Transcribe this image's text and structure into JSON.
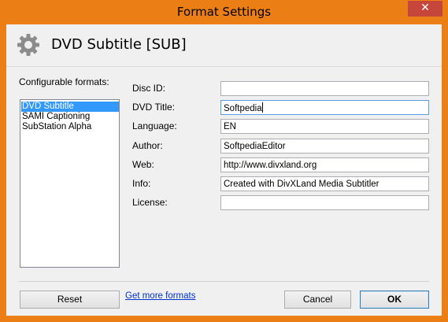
{
  "window": {
    "title": "Format Settings",
    "close_glyph": "✕"
  },
  "header": {
    "title": "DVD Subtitle [SUB]",
    "icon": "gear-icon"
  },
  "formats": {
    "label": "Configurable formats:",
    "items": [
      {
        "label": "DVD Subtitle",
        "selected": true
      },
      {
        "label": "SAMI Captioning",
        "selected": false
      },
      {
        "label": "SubStation Alpha",
        "selected": false
      }
    ]
  },
  "fields": {
    "disc_id": {
      "label": "Disc ID:",
      "value": ""
    },
    "dvd_title": {
      "label": "DVD Title:",
      "value": "Softpedia"
    },
    "language": {
      "label": "Language:",
      "value": "EN"
    },
    "author": {
      "label": "Author:",
      "value": "SoftpediaEditor"
    },
    "web": {
      "label": "Web:",
      "value": "http://www.divxland.org"
    },
    "info": {
      "label": "Info:",
      "value": "Created with DivXLand Media Subtitler"
    },
    "license": {
      "label": "License:",
      "value": ""
    }
  },
  "footer": {
    "reset_label": "Reset",
    "more_formats_link": "Get more formats",
    "cancel_label": "Cancel",
    "ok_label": "OK"
  },
  "colors": {
    "frame": "#eb7f16",
    "close": "#c7463b",
    "selection": "#3399ff",
    "link": "#0033cc"
  }
}
